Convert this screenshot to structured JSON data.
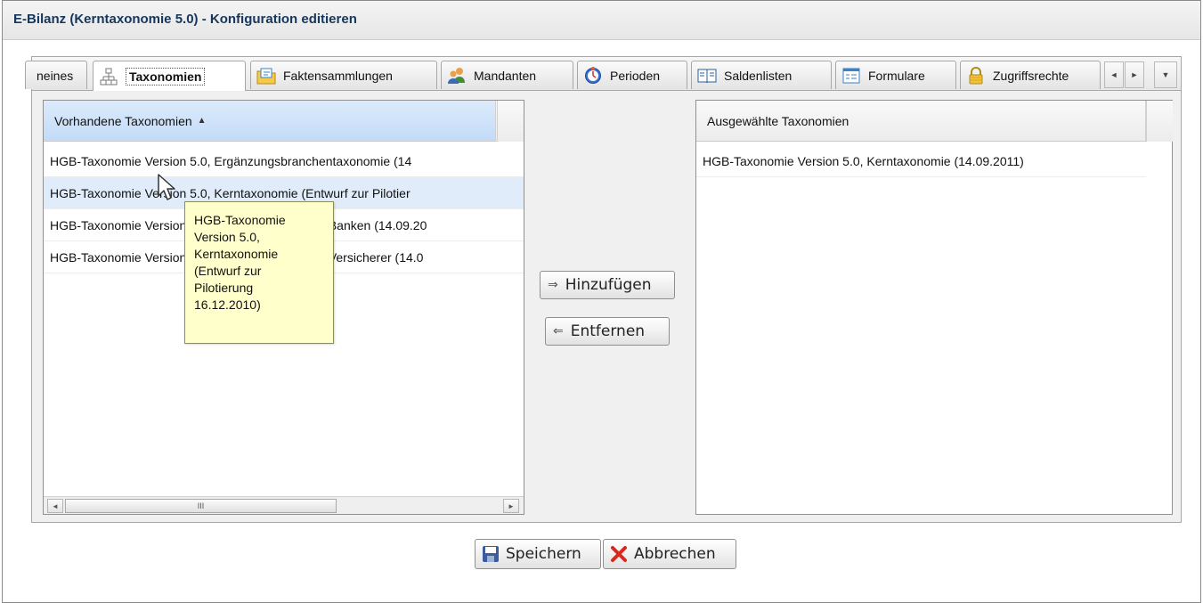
{
  "window": {
    "title": "E-Bilanz (Kerntaxonomie 5.0) - Konfiguration editieren"
  },
  "tabs": [
    {
      "label": "neines",
      "icon": "none"
    },
    {
      "label": "Taxonomien",
      "icon": "hierarchy-icon",
      "active": true
    },
    {
      "label": "Faktensammlungen",
      "icon": "folder-icon"
    },
    {
      "label": "Mandanten",
      "icon": "users-icon"
    },
    {
      "label": "Perioden",
      "icon": "clock-icon"
    },
    {
      "label": "Saldenlisten",
      "icon": "book-icon"
    },
    {
      "label": "Formulare",
      "icon": "form-icon"
    },
    {
      "label": "Zugriffsrechte",
      "icon": "lock-icon"
    }
  ],
  "tab_nav": {
    "prev": "◄",
    "next": "►",
    "menu": "▼"
  },
  "available": {
    "header": "Vorhandene Taxonomien",
    "sort_indicator": "▲",
    "rows": [
      "HGB-Taxonomie Version 5.0, Ergänzungsbranchentaxonomie (14",
      "HGB-Taxonomie Version 5.0, Kerntaxonomie (Entwurf zur Pilotier",
      "HGB-Taxonomie Version 5.0, Branchentaxonomie Banken (14.09.20",
      "HGB-Taxonomie Version 5.0, Branchentaxonomie Versicherer (14.0"
    ],
    "scroll_grip": "III"
  },
  "selected": {
    "header": "Ausgewählte Taxonomien",
    "rows": [
      "HGB-Taxonomie Version 5.0, Kerntaxonomie (14.09.2011)"
    ]
  },
  "actions": {
    "add": "Hinzufügen",
    "add_arrow": "⇒",
    "remove": "Entfernen",
    "remove_arrow": "⇐"
  },
  "tooltip": {
    "lines": [
      "HGB-Taxonomie",
      "Version 5.0,",
      "Kerntaxonomie",
      "(Entwurf zur",
      "Pilotierung",
      "16.12.2010)"
    ]
  },
  "footer": {
    "save": "Speichern",
    "cancel": "Abbrechen"
  },
  "colors": {
    "title": "#15375d",
    "sorted_header": "#c3dbf7",
    "hover_row": "#e0ecfa",
    "tooltip_bg": "#ffffcc",
    "cancel_icon": "#d9291c",
    "save_icon": "#3b5c9e"
  }
}
